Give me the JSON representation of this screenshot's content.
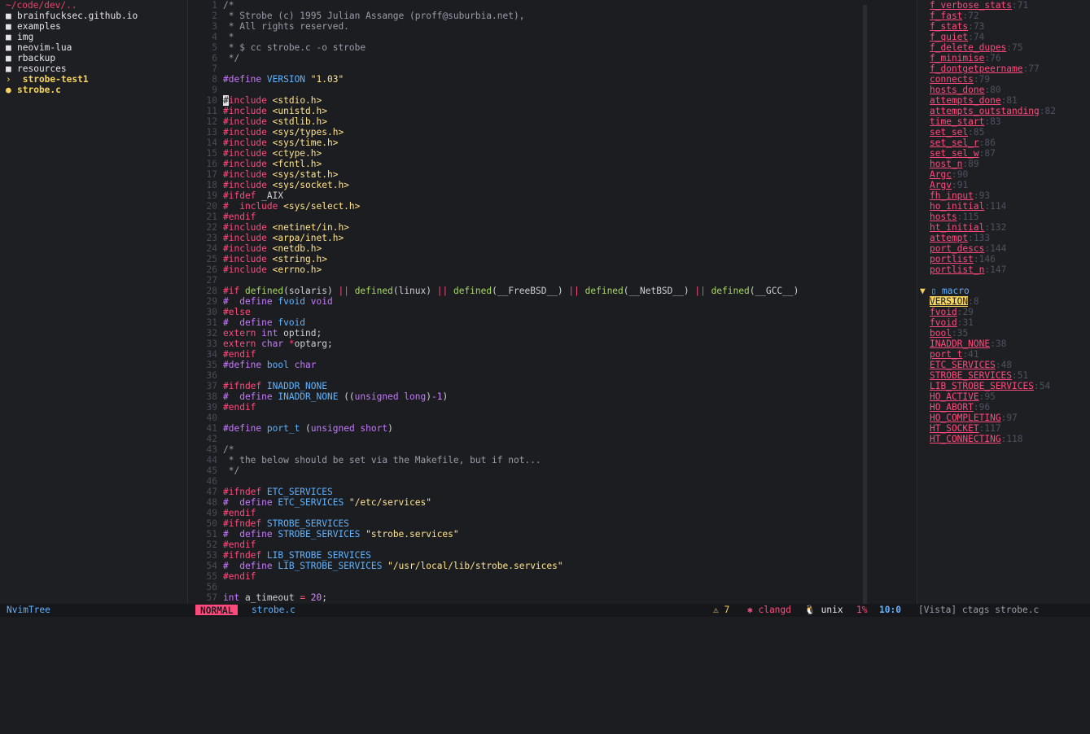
{
  "tree": {
    "root": "~/code/dev/..",
    "items": [
      {
        "icon": "folder-icon",
        "glyph": "■",
        "label": "brainfucksec.github.io",
        "kind": "dir"
      },
      {
        "icon": "folder-icon",
        "glyph": "■",
        "label": "examples",
        "kind": "dir"
      },
      {
        "icon": "folder-icon",
        "glyph": "■",
        "label": "img",
        "kind": "dir"
      },
      {
        "icon": "folder-icon",
        "glyph": "■",
        "label": "neovim-lua",
        "kind": "dir"
      },
      {
        "icon": "folder-icon",
        "glyph": "■",
        "label": "rbackup",
        "kind": "dir"
      },
      {
        "icon": "folder-icon",
        "glyph": "■",
        "label": "resources",
        "kind": "dir"
      },
      {
        "icon": "chevron-right-icon",
        "glyph": "›",
        "label": " strobe-test1",
        "kind": "open"
      },
      {
        "icon": "modified-dot-icon",
        "glyph": "●",
        "label": "strobe.c",
        "kind": "open"
      }
    ]
  },
  "editor": {
    "lines": [
      {
        "n": "1",
        "t": [
          [
            "c-com",
            "/*"
          ]
        ]
      },
      {
        "n": "2",
        "t": [
          [
            "c-com",
            " * Strobe (c) 1995 Julian Assange (proff@suburbia.net),"
          ]
        ]
      },
      {
        "n": "3",
        "t": [
          [
            "c-com",
            " * All rights reserved."
          ]
        ]
      },
      {
        "n": "4",
        "t": [
          [
            "c-com",
            " *"
          ]
        ]
      },
      {
        "n": "5",
        "t": [
          [
            "c-com",
            " * $ cc strobe.c -o strobe"
          ]
        ]
      },
      {
        "n": "6",
        "t": [
          [
            "c-com",
            " */"
          ]
        ]
      },
      {
        "n": "7",
        "t": []
      },
      {
        "n": "8",
        "t": [
          [
            "c-kw",
            "#define "
          ],
          [
            "c-mac",
            "VERSION "
          ],
          [
            "c-str",
            "\"1.03\""
          ]
        ]
      },
      {
        "n": "9",
        "t": []
      },
      {
        "n": "10",
        "t": [
          [
            "cursor",
            "#"
          ],
          [
            "c-pre",
            "include "
          ],
          [
            "c-str",
            "<stdio.h>"
          ]
        ]
      },
      {
        "n": "11",
        "t": [
          [
            "c-pre",
            "#include "
          ],
          [
            "c-str",
            "<unistd.h>"
          ]
        ]
      },
      {
        "n": "12",
        "t": [
          [
            "c-pre",
            "#include "
          ],
          [
            "c-str",
            "<stdlib.h>"
          ]
        ]
      },
      {
        "n": "13",
        "t": [
          [
            "c-pre",
            "#include "
          ],
          [
            "c-str",
            "<sys/types.h>"
          ]
        ]
      },
      {
        "n": "14",
        "t": [
          [
            "c-pre",
            "#include "
          ],
          [
            "c-str",
            "<sys/time.h>"
          ]
        ]
      },
      {
        "n": "15",
        "t": [
          [
            "c-pre",
            "#include "
          ],
          [
            "c-str",
            "<ctype.h>"
          ]
        ]
      },
      {
        "n": "16",
        "t": [
          [
            "c-pre",
            "#include "
          ],
          [
            "c-str",
            "<fcntl.h>"
          ]
        ]
      },
      {
        "n": "17",
        "t": [
          [
            "c-pre",
            "#include "
          ],
          [
            "c-str",
            "<sys/stat.h>"
          ]
        ]
      },
      {
        "n": "18",
        "t": [
          [
            "c-pre",
            "#include "
          ],
          [
            "c-str",
            "<sys/socket.h>"
          ]
        ]
      },
      {
        "n": "19",
        "t": [
          [
            "c-pre",
            "#ifdef "
          ],
          [
            "",
            "_AIX"
          ]
        ]
      },
      {
        "n": "20",
        "t": [
          [
            "c-pre",
            "#  include "
          ],
          [
            "c-str",
            "<sys/select.h>"
          ]
        ]
      },
      {
        "n": "21",
        "t": [
          [
            "c-pre",
            "#endif"
          ]
        ]
      },
      {
        "n": "22",
        "t": [
          [
            "c-pre",
            "#include "
          ],
          [
            "c-str",
            "<netinet/in.h>"
          ]
        ]
      },
      {
        "n": "23",
        "t": [
          [
            "c-pre",
            "#include "
          ],
          [
            "c-str",
            "<arpa/inet.h>"
          ]
        ]
      },
      {
        "n": "24",
        "t": [
          [
            "c-pre",
            "#include "
          ],
          [
            "c-str",
            "<netdb.h>"
          ]
        ]
      },
      {
        "n": "25",
        "t": [
          [
            "c-pre",
            "#include "
          ],
          [
            "c-str",
            "<string.h>"
          ]
        ]
      },
      {
        "n": "26",
        "t": [
          [
            "c-pre",
            "#include "
          ],
          [
            "c-str",
            "<errno.h>"
          ]
        ]
      },
      {
        "n": "27",
        "t": []
      },
      {
        "n": "28",
        "t": [
          [
            "c-pre",
            "#if "
          ],
          [
            "c-fn",
            "defined"
          ],
          [
            "",
            "(solaris) "
          ],
          [
            "c-op",
            "|| "
          ],
          [
            "c-fn",
            "defined"
          ],
          [
            "",
            "(linux) "
          ],
          [
            "c-op",
            "|| "
          ],
          [
            "c-fn",
            "defined"
          ],
          [
            "",
            "(__FreeBSD__) "
          ],
          [
            "c-op",
            "|| "
          ],
          [
            "c-fn",
            "defined"
          ],
          [
            "",
            "(__NetBSD__) "
          ],
          [
            "c-op",
            "|| "
          ],
          [
            "c-fn",
            "defined"
          ],
          [
            "",
            "(__GCC__)"
          ]
        ]
      },
      {
        "n": "29",
        "t": [
          [
            "c-kw",
            "#  define "
          ],
          [
            "c-mac",
            "fvoid "
          ],
          [
            "c-kw",
            "void"
          ]
        ]
      },
      {
        "n": "30",
        "t": [
          [
            "c-pre",
            "#else"
          ]
        ]
      },
      {
        "n": "31",
        "t": [
          [
            "c-kw",
            "#  define "
          ],
          [
            "c-mac",
            "fvoid"
          ]
        ]
      },
      {
        "n": "32",
        "t": [
          [
            "c-pre",
            "extern "
          ],
          [
            "c-kw",
            "int "
          ],
          [
            "",
            "optind;"
          ]
        ]
      },
      {
        "n": "33",
        "t": [
          [
            "c-pre",
            "extern "
          ],
          [
            "c-kw",
            "char "
          ],
          [
            "c-op",
            "*"
          ],
          [
            "",
            "optarg;"
          ]
        ]
      },
      {
        "n": "34",
        "t": [
          [
            "c-pre",
            "#endif"
          ]
        ]
      },
      {
        "n": "35",
        "t": [
          [
            "c-kw",
            "#define "
          ],
          [
            "c-mac",
            "bool "
          ],
          [
            "c-kw",
            "char"
          ]
        ]
      },
      {
        "n": "36",
        "t": []
      },
      {
        "n": "37",
        "t": [
          [
            "c-pre",
            "#ifndef "
          ],
          [
            "c-mac",
            "INADDR_NONE"
          ]
        ]
      },
      {
        "n": "38",
        "t": [
          [
            "c-kw",
            "#  define "
          ],
          [
            "c-mac",
            "INADDR_NONE "
          ],
          [
            "",
            "(("
          ],
          [
            "c-kw",
            "unsigned long"
          ],
          [
            "",
            ")"
          ],
          [
            "c-num",
            "-1"
          ],
          [
            "",
            ")"
          ]
        ]
      },
      {
        "n": "39",
        "t": [
          [
            "c-pre",
            "#endif"
          ]
        ]
      },
      {
        "n": "40",
        "t": []
      },
      {
        "n": "41",
        "t": [
          [
            "c-kw",
            "#define "
          ],
          [
            "c-mac",
            "port_t "
          ],
          [
            "",
            "("
          ],
          [
            "c-kw",
            "unsigned short"
          ],
          [
            "",
            ")"
          ]
        ]
      },
      {
        "n": "42",
        "t": []
      },
      {
        "n": "43",
        "t": [
          [
            "c-com",
            "/*"
          ]
        ]
      },
      {
        "n": "44",
        "t": [
          [
            "c-com",
            " * the below should be set via the Makefile, but if not..."
          ]
        ]
      },
      {
        "n": "45",
        "t": [
          [
            "c-com",
            " */"
          ]
        ]
      },
      {
        "n": "46",
        "t": []
      },
      {
        "n": "47",
        "t": [
          [
            "c-pre",
            "#ifndef "
          ],
          [
            "c-mac",
            "ETC_SERVICES"
          ]
        ]
      },
      {
        "n": "48",
        "t": [
          [
            "c-kw",
            "#  define "
          ],
          [
            "c-mac",
            "ETC_SERVICES "
          ],
          [
            "c-str",
            "\"/etc/services\""
          ]
        ]
      },
      {
        "n": "49",
        "t": [
          [
            "c-pre",
            "#endif"
          ]
        ]
      },
      {
        "n": "50",
        "t": [
          [
            "c-pre",
            "#ifndef "
          ],
          [
            "c-mac",
            "STROBE_SERVICES"
          ]
        ]
      },
      {
        "n": "51",
        "t": [
          [
            "c-kw",
            "#  define "
          ],
          [
            "c-mac",
            "STROBE_SERVICES "
          ],
          [
            "c-str",
            "\"strobe.services\""
          ]
        ]
      },
      {
        "n": "52",
        "t": [
          [
            "c-pre",
            "#endif"
          ]
        ]
      },
      {
        "n": "53",
        "t": [
          [
            "c-pre",
            "#ifndef "
          ],
          [
            "c-mac",
            "LIB_STROBE_SERVICES"
          ]
        ]
      },
      {
        "n": "54",
        "t": [
          [
            "c-kw",
            "#  define "
          ],
          [
            "c-mac",
            "LIB_STROBE_SERVICES "
          ],
          [
            "c-str",
            "\"/usr/local/lib/strobe.services\""
          ]
        ]
      },
      {
        "n": "55",
        "t": [
          [
            "c-pre",
            "#endif"
          ]
        ]
      },
      {
        "n": "56",
        "t": []
      },
      {
        "n": "57",
        "t": [
          [
            "c-kw",
            "int "
          ],
          [
            "",
            "a_timeout "
          ],
          [
            "c-op",
            "= "
          ],
          [
            "c-num",
            "20"
          ],
          [
            "",
            ";"
          ]
        ]
      }
    ]
  },
  "vista": {
    "variables": [
      [
        "f_verbose_stats",
        "71"
      ],
      [
        "f_fast",
        "72"
      ],
      [
        "f_stats",
        "73"
      ],
      [
        "f_quiet",
        "74"
      ],
      [
        "f_delete_dupes",
        "75"
      ],
      [
        "f_minimise",
        "76"
      ],
      [
        "f_dontgetpeername",
        "77"
      ],
      [
        "connects",
        "79"
      ],
      [
        "hosts_done",
        "80"
      ],
      [
        "attempts_done",
        "81"
      ],
      [
        "attempts_outstanding",
        "82"
      ],
      [
        "time_start",
        "83"
      ],
      [
        "set_sel",
        "85"
      ],
      [
        "set_sel_r",
        "86"
      ],
      [
        "set_sel_w",
        "87"
      ],
      [
        "host_n",
        "89"
      ],
      [
        "Argc",
        "90"
      ],
      [
        "Argv",
        "91"
      ],
      [
        "fh_input",
        "93"
      ],
      [
        "ho_initial",
        "114"
      ],
      [
        "hosts",
        "115"
      ],
      [
        "ht_initial",
        "132"
      ],
      [
        "attempt",
        "133"
      ],
      [
        "port_descs",
        "144"
      ],
      [
        "portlist",
        "146"
      ],
      [
        "portlist_n",
        "147"
      ]
    ],
    "section_arrow": "▼",
    "section_icon": "▯",
    "section_label": "macro",
    "macros": [
      [
        "VERSION",
        "8"
      ],
      [
        "fvoid",
        "29"
      ],
      [
        "fvoid",
        "31"
      ],
      [
        "bool",
        "35"
      ],
      [
        "INADDR_NONE",
        "38"
      ],
      [
        "port_t",
        "41"
      ],
      [
        "ETC_SERVICES",
        "48"
      ],
      [
        "STROBE_SERVICES",
        "51"
      ],
      [
        "LIB_STROBE_SERVICES",
        "54"
      ],
      [
        "HO_ACTIVE",
        "95"
      ],
      [
        "HO_ABORT",
        "96"
      ],
      [
        "HO_COMPLETING",
        "97"
      ],
      [
        "HT_SOCKET",
        "117"
      ],
      [
        "HT_CONNECTING",
        "118"
      ]
    ]
  },
  "status": {
    "tree": "NvimTree",
    "mode": "NORMAL",
    "file": "strobe.c",
    "warnings": "⚠ 7",
    "lsp": "✱ clangd",
    "encoding": "🐧 unix",
    "percent": "1%",
    "position": "10:0",
    "vista": "[Vista] ctags strobe.c"
  },
  "colors": {
    "accent_pink": "#ff4a7e",
    "accent_blue": "#5fb3ff",
    "accent_yellow": "#f4d35e",
    "background": "#1c1d21"
  }
}
